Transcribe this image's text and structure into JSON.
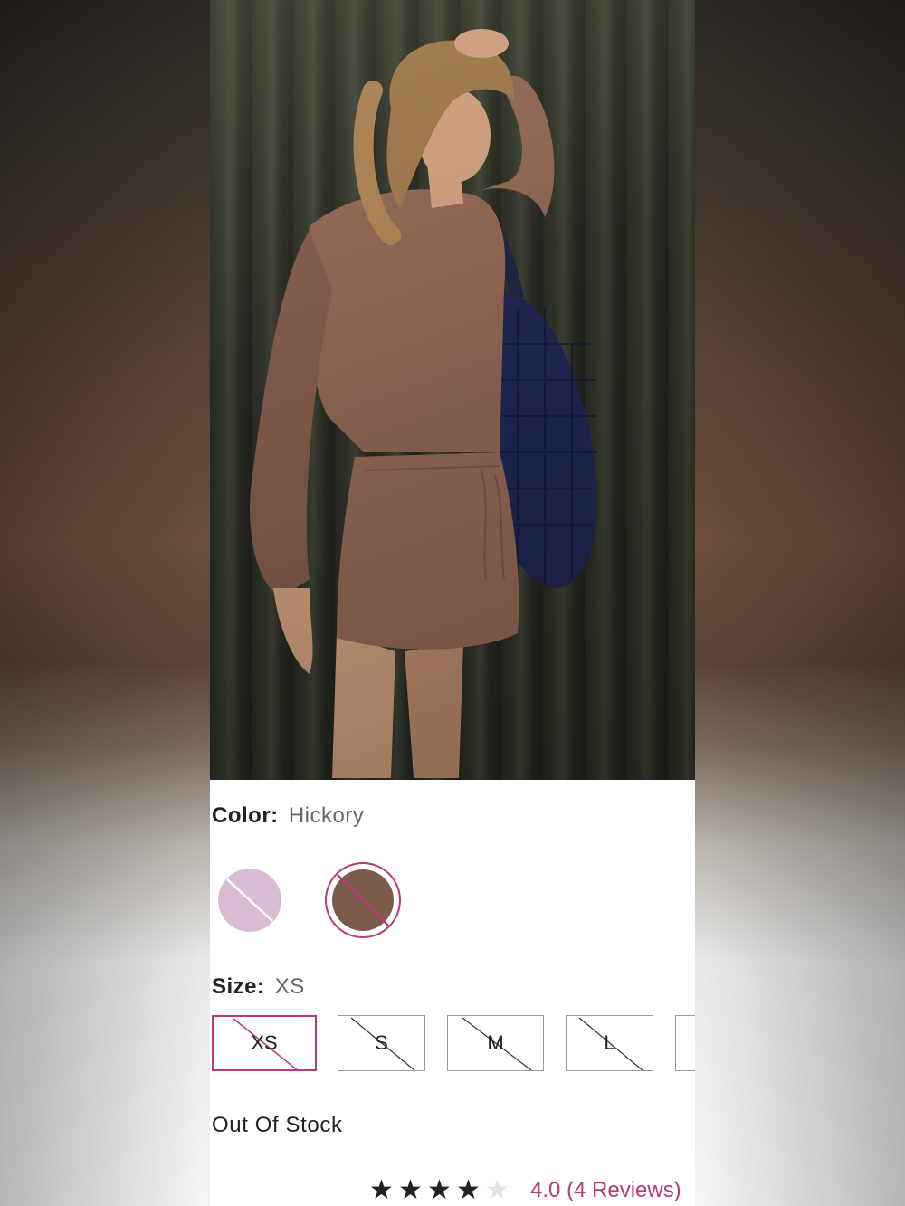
{
  "product": {
    "image_alt": "",
    "color_label": "Color:",
    "color_value": "Hickory",
    "size_label": "Size:",
    "size_value": "XS",
    "stock_status": "Out Of Stock"
  },
  "color_swatches": [
    {
      "name": "lavender-swatch",
      "color": "#d7bcd4",
      "selected": false,
      "unavailable": true
    },
    {
      "name": "hickory-swatch",
      "color": "#7b5c4a",
      "selected": true,
      "unavailable": true
    }
  ],
  "sizes": [
    {
      "label": "XS",
      "selected": true,
      "unavailable": true
    },
    {
      "label": "S",
      "selected": false,
      "unavailable": true
    },
    {
      "label": "M",
      "selected": false,
      "unavailable": true
    },
    {
      "label": "L",
      "selected": false,
      "unavailable": true
    },
    {
      "label": "",
      "selected": false,
      "unavailable": true
    }
  ],
  "rating": {
    "stars_filled": 4,
    "stars_total": 5,
    "text": "4.0 (4 Reviews)"
  },
  "colors": {
    "accent": "#b83a7a",
    "text": "#222222",
    "muted": "#666666",
    "border": "#9a9a9a"
  }
}
